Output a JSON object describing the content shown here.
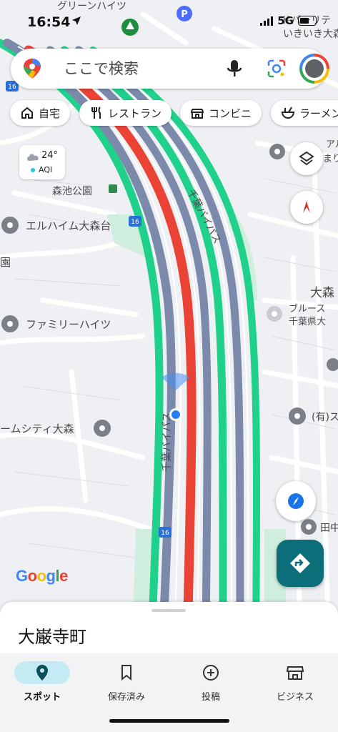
{
  "status_bar": {
    "time": "16:54",
    "network": "5G"
  },
  "search": {
    "placeholder": "ここで検索"
  },
  "chips": [
    {
      "label": "自宅",
      "icon": "home-icon"
    },
    {
      "label": "レストラン",
      "icon": "restaurant-icon"
    },
    {
      "label": "コンビニ",
      "icon": "store-icon"
    },
    {
      "label": "ラーメン",
      "icon": "ramen-icon"
    }
  ],
  "weather": {
    "temperature": "24°",
    "aqi_label": "AQI"
  },
  "map_labels": {
    "park": "森池公園",
    "place1": "エルハイム大森台",
    "place2": "ファミリーハイツ",
    "place3": "ームシティ大森",
    "place4": "(有)ス",
    "place5": "田中",
    "place6": "園",
    "district": "大森",
    "poi_blue": "ブルース",
    "poi_blue2": "千葉県大",
    "highway_top": "千葉バイパス",
    "highway_mid": "千葉バイパス",
    "route_number": "16",
    "top_place": "グリーンハイツ",
    "top_right1": "ドパーリテ",
    "top_right2": "いきいき大森",
    "top_right3": "アル",
    "top_right4": "まり"
  },
  "colors": {
    "traffic_red": "#ea4335",
    "traffic_green": "#1fd18a",
    "road_slate": "#7b8aab",
    "accent_teal": "#0b6e78",
    "nav_active_bg": "#c4eaf4"
  },
  "google_logo": {
    "G": "G",
    "o1": "o",
    "o2": "o",
    "g": "g",
    "l": "l",
    "e": "e"
  },
  "sheet": {
    "title": "大巌寺町"
  },
  "bottom_nav": [
    {
      "label": "スポット",
      "icon": "location-pin-icon",
      "active": true
    },
    {
      "label": "保存済み",
      "icon": "bookmark-icon",
      "active": false
    },
    {
      "label": "投稿",
      "icon": "add-circle-icon",
      "active": false
    },
    {
      "label": "ビジネス",
      "icon": "storefront-icon",
      "active": false
    }
  ]
}
